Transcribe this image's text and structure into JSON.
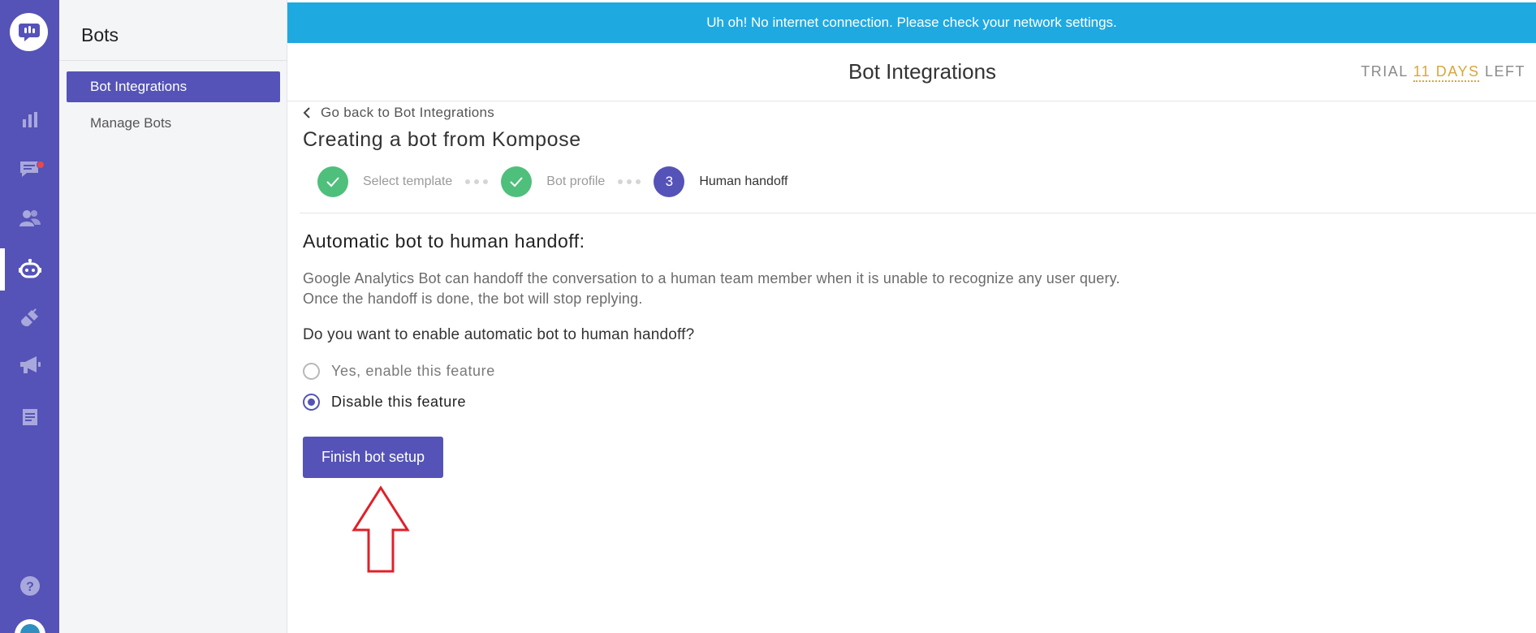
{
  "banner": {
    "text": "Uh oh! No internet connection. Please check your network settings."
  },
  "rail": {
    "icons": [
      "chat-logo-icon",
      "bar-chart-icon",
      "conversations-icon",
      "users-icon",
      "bot-icon",
      "integrations-icon",
      "campaigns-icon",
      "docs-icon",
      "help-icon",
      "avatar"
    ],
    "active": "bot-icon",
    "notification_color": "#e8484b"
  },
  "sidebar": {
    "title": "Bots",
    "items": [
      {
        "label": "Bot Integrations",
        "active": true
      },
      {
        "label": "Manage Bots",
        "active": false
      }
    ]
  },
  "header": {
    "title": "Bot Integrations",
    "trial_prefix": "TRIAL",
    "trial_days": "11 DAYS",
    "trial_suffix": "LEFT"
  },
  "content": {
    "back_link": "Go back to Bot Integrations",
    "title": "Creating a bot from Kompose",
    "steps": [
      {
        "label": "Select template",
        "status": "done"
      },
      {
        "label": "Bot profile",
        "status": "done"
      },
      {
        "number": "3",
        "label": "Human handoff",
        "status": "current"
      }
    ],
    "section_title": "Automatic bot to human handoff:",
    "description_line1": "Google Analytics Bot can handoff the conversation to a human team member when it is unable to recognize any user query.",
    "description_line2": "Once the handoff is done, the bot will stop replying.",
    "question": "Do you want to enable automatic bot to human handoff?",
    "options": [
      {
        "label": "Yes, enable this feature",
        "selected": false
      },
      {
        "label": "Disable this feature",
        "selected": true
      }
    ],
    "finish_button": "Finish bot setup"
  },
  "colors": {
    "brand": "#5553b7",
    "banner": "#1fa9e1",
    "step_done": "#4fbf7c",
    "trial_accent": "#d9a73b",
    "annotation_arrow": "#e0202a"
  }
}
